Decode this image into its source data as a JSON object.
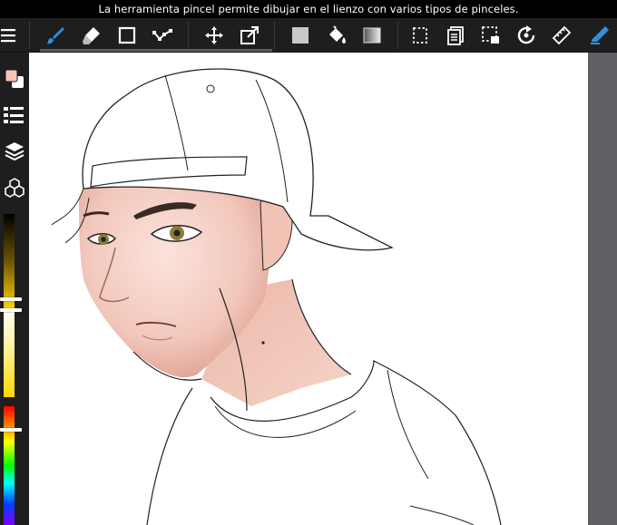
{
  "status_bar": {
    "text": "La herramienta pincel permite dibujar en el lienzo con varios tipos de pinceles."
  },
  "toolbar": {
    "tools": [
      {
        "id": "menu",
        "icon": "menu-icon"
      },
      {
        "id": "brush",
        "icon": "brush-icon",
        "active": true
      },
      {
        "id": "eraser",
        "icon": "eraser-icon"
      },
      {
        "id": "shape",
        "icon": "rectangle-icon"
      },
      {
        "id": "lasso",
        "icon": "vector-icon"
      },
      {
        "id": "move",
        "icon": "move-icon"
      },
      {
        "id": "transform",
        "icon": "transform-icon"
      },
      {
        "id": "fill-color",
        "icon": "fill-square-icon"
      },
      {
        "id": "bucket",
        "icon": "bucket-icon"
      },
      {
        "id": "gradient",
        "icon": "gradient-icon"
      },
      {
        "id": "select",
        "icon": "selection-icon"
      },
      {
        "id": "copy",
        "icon": "copy-icon"
      },
      {
        "id": "select-layer",
        "icon": "select-layer-icon"
      },
      {
        "id": "rotate",
        "icon": "rotate-icon"
      },
      {
        "id": "ruler",
        "icon": "ruler-icon"
      },
      {
        "id": "pen",
        "icon": "pen-icon"
      }
    ]
  },
  "sidebar": {
    "items": [
      {
        "id": "color",
        "icon": "color-swatch-icon"
      },
      {
        "id": "brush-settings",
        "icon": "brush-list-icon"
      },
      {
        "id": "layers",
        "icon": "layers-icon"
      },
      {
        "id": "materials",
        "icon": "materials-icon"
      }
    ],
    "primary_color": "#f4c6b6",
    "secondary_color": "#ffffff"
  },
  "sliders": {
    "opacity_value": 0.78,
    "brightness_value": 0.0,
    "hue_value": 0.18
  },
  "colors": {
    "toolbar_bg": "#1e1e1e",
    "accent": "#2f8fe0",
    "canvas_bg": "#ffffff",
    "gutter": "#5f6063"
  }
}
